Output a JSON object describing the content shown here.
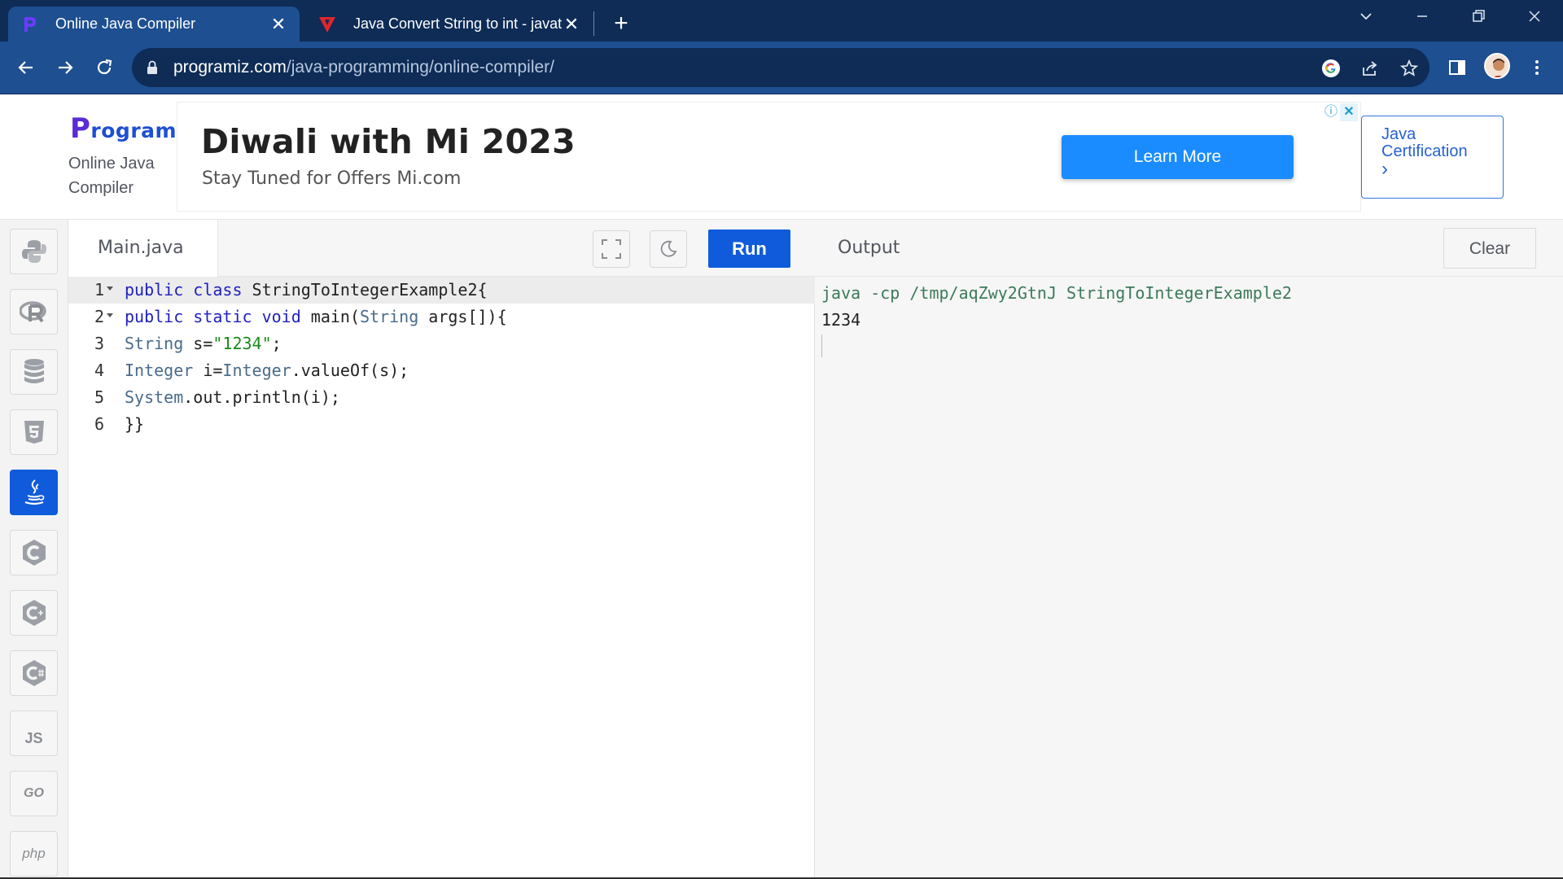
{
  "browser": {
    "tabs": [
      {
        "title": "Online Java Compiler",
        "active": true
      },
      {
        "title": "Java Convert String to int - javatpoint",
        "active": false
      }
    ],
    "url_host": "programiz.com",
    "url_path": "/java-programming/online-compiler/"
  },
  "header": {
    "logo": "rogramiz",
    "logo_p": "P",
    "subtitle_line1": "Online Java",
    "subtitle_line2": "Compiler"
  },
  "ad": {
    "headline": "Diwali with Mi 2023",
    "tagline": "Stay Tuned for Offers Mi.com",
    "cta": "Learn More"
  },
  "cert_link": {
    "line1": "Java",
    "line2": "Certification",
    "arrow": "›"
  },
  "languages": [
    {
      "name": "python",
      "active": false
    },
    {
      "name": "r",
      "active": false
    },
    {
      "name": "sql",
      "active": false
    },
    {
      "name": "html",
      "active": false
    },
    {
      "name": "java",
      "active": true
    },
    {
      "name": "c",
      "active": false
    },
    {
      "name": "cpp",
      "active": false
    },
    {
      "name": "csharp",
      "active": false
    },
    {
      "name": "JS",
      "active": false
    },
    {
      "name": "GO",
      "active": false
    },
    {
      "name": "php",
      "active": false
    }
  ],
  "editor": {
    "file_tab": "Main.java",
    "run_label": "Run",
    "lines": [
      {
        "num": "1",
        "text": "public class StringToIntegerExample2{"
      },
      {
        "num": "2",
        "text": "public static void main(String args[]){"
      },
      {
        "num": "3",
        "text": "String s=\"1234\";"
      },
      {
        "num": "4",
        "text": "Integer i=Integer.valueOf(s);"
      },
      {
        "num": "5",
        "text": "System.out.println(i);"
      },
      {
        "num": "6",
        "text": "}}"
      }
    ]
  },
  "output": {
    "title": "Output",
    "clear_label": "Clear",
    "command": "java -cp /tmp/aqZwy2GtnJ StringToIntegerExample2",
    "result": "1234"
  },
  "colors": {
    "brand_blue": "#0f5bdb",
    "chrome_dark": "#0e2c56",
    "chrome_mid": "#1d4f91",
    "ad_button": "#1a8cff"
  }
}
